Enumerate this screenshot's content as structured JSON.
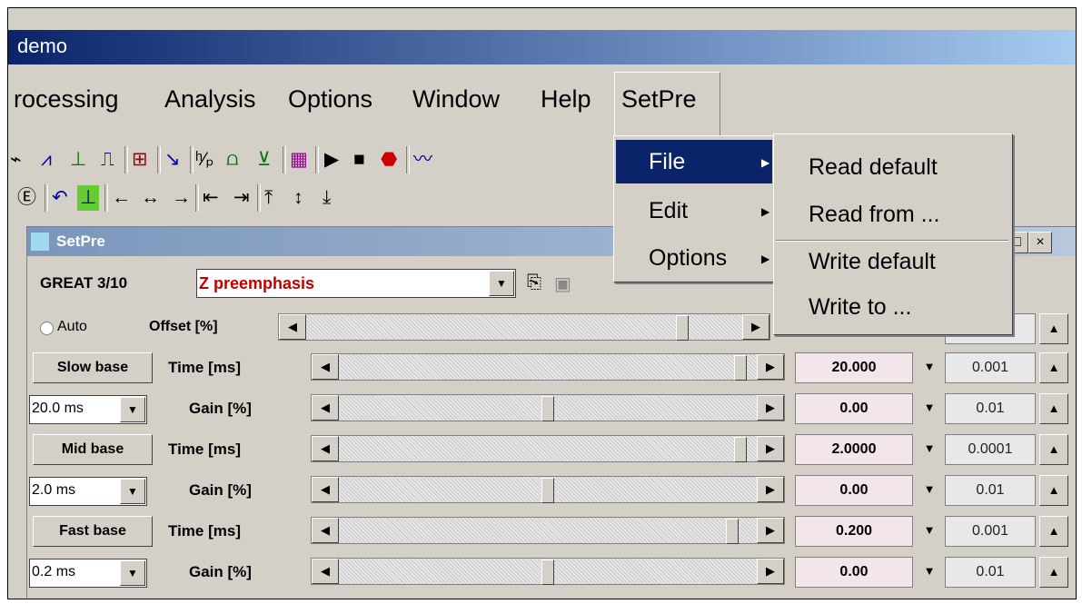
{
  "window": {
    "title": "demo"
  },
  "menubar": {
    "items": [
      "rocessing",
      "Analysis",
      "Options",
      "Window",
      "Help",
      "SetPre"
    ],
    "selected": "SetPre"
  },
  "toolbar1": {
    "icons": [
      "trigger-icon",
      "peak-icon",
      "baseline-icon",
      "step-icon",
      "histogram-icon",
      "slope-icon",
      "ratio-icon",
      "spectrum-icon",
      "tree-icon",
      "grid-icon",
      "play-icon",
      "stop-icon",
      "stop-sign-icon",
      "waveform-icon"
    ]
  },
  "toolbar2": {
    "icons": [
      "zoom-icon",
      "undo-icon",
      "plot-icon",
      "arrow-left-icon",
      "arrow-both-icon",
      "arrow-right-icon",
      "first-icon",
      "last-icon",
      "top-icon",
      "updown-icon",
      "bottom-icon"
    ]
  },
  "menu": {
    "items": [
      {
        "label": "File",
        "submenu": true,
        "highlighted": true
      },
      {
        "label": "Edit",
        "submenu": true,
        "highlighted": false
      },
      {
        "label": "Options",
        "submenu": true,
        "highlighted": false
      }
    ],
    "file_submenu": [
      "Read default",
      "Read from ...",
      "Write default",
      "Write to ..."
    ],
    "highlight_color": "#0a246a"
  },
  "setpre": {
    "title": "SetPre",
    "header": {
      "label": "GREAT 3/10",
      "selected": "Z preemphasis",
      "selected_color": "#c00000"
    },
    "offset_row": {
      "radio_label": "Auto",
      "label": "Offset [%]",
      "level": 0.87
    },
    "rows": [
      {
        "left_label": "Slow base",
        "left_type": "button",
        "param": "Time [ms]",
        "level": 0.97,
        "value": "20.000",
        "step": "0.001"
      },
      {
        "left_label": "20.0 ms",
        "left_type": "combo",
        "param": "Gain [%]",
        "level": 0.5,
        "value": "0.00",
        "step": "0.01"
      },
      {
        "left_label": "Mid base",
        "left_type": "button",
        "param": "Time [ms]",
        "level": 0.97,
        "value": "2.0000",
        "step": "0.0001"
      },
      {
        "left_label": "2.0 ms",
        "left_type": "combo",
        "param": "Gain [%]",
        "level": 0.5,
        "value": "0.00",
        "step": "0.01"
      },
      {
        "left_label": "Fast base",
        "left_type": "button",
        "param": "Time [ms]",
        "level": 0.95,
        "value": "0.200",
        "step": "0.001"
      },
      {
        "left_label": "0.2 ms",
        "left_type": "combo",
        "param": "Gain [%]",
        "level": 0.5,
        "value": "0.00",
        "step": "0.01"
      }
    ]
  }
}
